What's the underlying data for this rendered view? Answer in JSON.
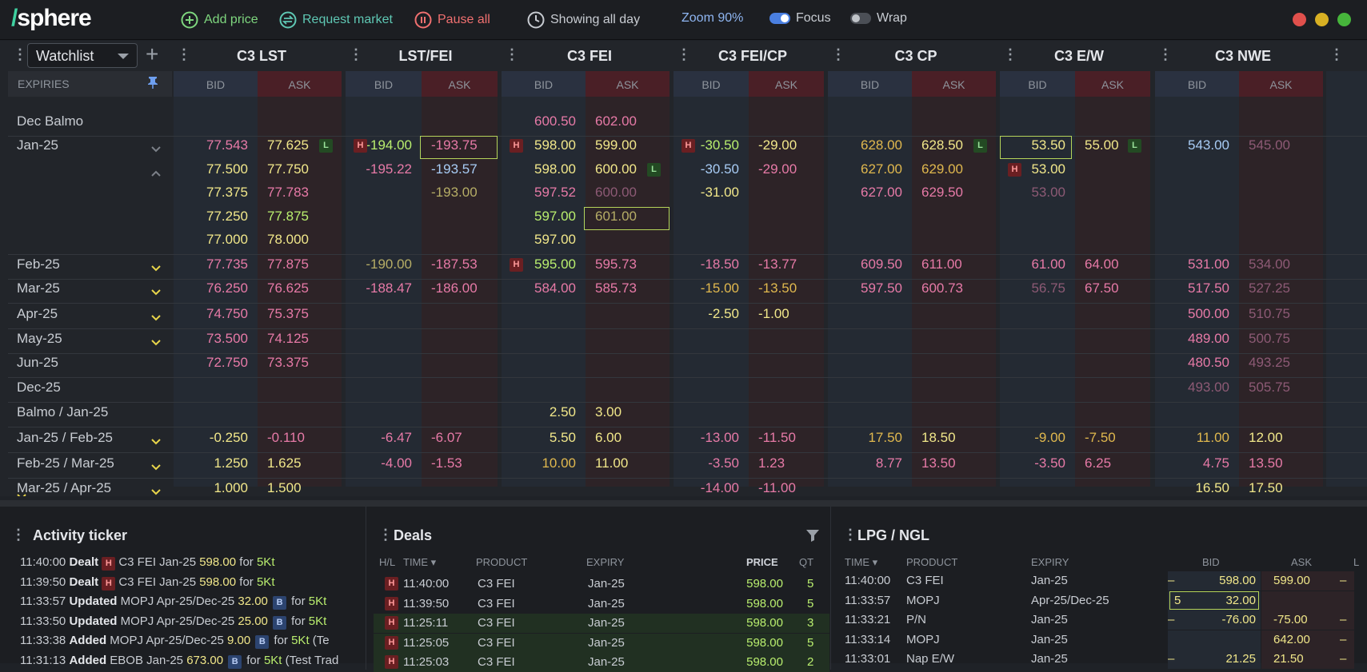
{
  "app": {
    "logo_slash": "/",
    "logo_text": "sphere"
  },
  "toolbar": {
    "add_price": "Add price",
    "request_market": "Request market",
    "pause_all": "Pause all",
    "showing": "Showing all day",
    "zoom": "Zoom 90%",
    "focus": "Focus",
    "wrap": "Wrap",
    "focus_on": true,
    "wrap_on": false
  },
  "colors": {
    "accent": "#3fd1a0",
    "bid_header": "#2a3140",
    "ask_header": "#4a1f26",
    "selection": "#b6d45a"
  },
  "watchlist": {
    "selected": "Watchlist",
    "expiries_label": "EXPIRIES"
  },
  "columns": [
    {
      "name": "C3 LST",
      "bid": "BID",
      "ask": "ASK"
    },
    {
      "name": "LST/FEI",
      "bid": "BID",
      "ask": "ASK"
    },
    {
      "name": "C3 FEI",
      "bid": "BID",
      "ask": "ASK"
    },
    {
      "name": "C3 FEI/CP",
      "bid": "BID",
      "ask": "ASK"
    },
    {
      "name": "C3 CP",
      "bid": "BID",
      "ask": "ASK"
    },
    {
      "name": "C3 E/W",
      "bid": "BID",
      "ask": "ASK"
    },
    {
      "name": "C3 NWE",
      "bid": "BID",
      "ask": "ASK"
    }
  ],
  "rows": [
    {
      "label": "Dec Balmo",
      "chev": ""
    },
    {
      "label": "Jan-25",
      "chev": "down-grey"
    },
    {
      "label": "",
      "chev": "up-grey"
    },
    {
      "label": "",
      "chev": ""
    },
    {
      "label": "",
      "chev": ""
    },
    {
      "label": "",
      "chev": ""
    },
    {
      "label": "Feb-25",
      "chev": "down"
    },
    {
      "label": "Mar-25",
      "chev": "down"
    },
    {
      "label": "Apr-25",
      "chev": "down"
    },
    {
      "label": "May-25",
      "chev": "down"
    },
    {
      "label": "Jun-25",
      "chev": ""
    },
    {
      "label": "Dec-25",
      "chev": ""
    },
    {
      "label": "Balmo / Jan-25",
      "chev": ""
    },
    {
      "label": "Jan-25 / Feb-25",
      "chev": "down"
    },
    {
      "label": "Feb-25 / Mar-25",
      "chev": "down"
    },
    {
      "label": "Mar-25 / Apr-25",
      "chev": "down"
    }
  ],
  "cells": [
    {
      "r": 0,
      "c": 2,
      "bid": "600.50",
      "bc": "p",
      "ask": "602.00",
      "ac": "p"
    },
    {
      "r": 1,
      "c": 0,
      "bid": "77.543",
      "bc": "p",
      "ask": "77.625",
      "ac": "y",
      "bL": true
    },
    {
      "r": 1,
      "c": 1,
      "bid": "-194.00",
      "bc": "g",
      "ask": "-193.75",
      "ac": "p",
      "bH": true,
      "selAsk": true
    },
    {
      "r": 1,
      "c": 2,
      "bid": "598.00",
      "bc": "y",
      "ask": "599.00",
      "ac": "y",
      "bH": true
    },
    {
      "r": 1,
      "c": 3,
      "bid": "-30.50",
      "bc": "g",
      "ask": "-29.00",
      "ac": "y",
      "bH": true
    },
    {
      "r": 1,
      "c": 4,
      "bid": "628.00",
      "bc": "o",
      "ask": "628.50",
      "ac": "y",
      "bL": true
    },
    {
      "r": 1,
      "c": 5,
      "bid": "53.50",
      "bc": "y",
      "ask": "55.00",
      "ac": "y",
      "bL": true,
      "selBid": true
    },
    {
      "r": 1,
      "c": 6,
      "bid": "543.00",
      "bc": "b",
      "ask": "545.00",
      "ac": "dp"
    },
    {
      "r": 2,
      "c": 0,
      "bid": "77.500",
      "bc": "y",
      "ask": "77.750",
      "ac": "y"
    },
    {
      "r": 2,
      "c": 1,
      "bid": "-195.22",
      "bc": "p",
      "ask": "-193.57",
      "ac": "b"
    },
    {
      "r": 2,
      "c": 2,
      "bid": "598.00",
      "bc": "y",
      "ask": "600.00",
      "ac": "y",
      "bL": true
    },
    {
      "r": 2,
      "c": 3,
      "bid": "-30.50",
      "bc": "b",
      "ask": "-29.00",
      "ac": "p"
    },
    {
      "r": 2,
      "c": 4,
      "bid": "627.00",
      "bc": "o",
      "ask": "629.00",
      "ac": "o"
    },
    {
      "r": 2,
      "c": 5,
      "bid": "53.00",
      "bc": "y",
      "ask": "",
      "ac": "y",
      "bHbid": true
    },
    {
      "r": 3,
      "c": 0,
      "bid": "77.375",
      "bc": "y",
      "ask": "77.783",
      "ac": "p"
    },
    {
      "r": 3,
      "c": 1,
      "bid": "",
      "bc": "y",
      "ask": "-193.00",
      "ac": "dy"
    },
    {
      "r": 3,
      "c": 2,
      "bid": "597.52",
      "bc": "p",
      "ask": "600.00",
      "ac": "dp"
    },
    {
      "r": 3,
      "c": 3,
      "bid": "-31.00",
      "bc": "y",
      "ask": "",
      "ac": "y"
    },
    {
      "r": 3,
      "c": 4,
      "bid": "627.00",
      "bc": "p",
      "ask": "629.50",
      "ac": "p"
    },
    {
      "r": 3,
      "c": 5,
      "bid": "53.00",
      "bc": "dp",
      "ask": "",
      "ac": "y"
    },
    {
      "r": 4,
      "c": 0,
      "bid": "77.250",
      "bc": "y",
      "ask": "77.875",
      "ac": "g"
    },
    {
      "r": 4,
      "c": 2,
      "bid": "597.00",
      "bc": "g",
      "ask": "601.00",
      "ac": "dy",
      "selAsk": true
    },
    {
      "r": 5,
      "c": 0,
      "bid": "77.000",
      "bc": "y",
      "ask": "78.000",
      "ac": "y"
    },
    {
      "r": 5,
      "c": 2,
      "bid": "597.00",
      "bc": "y",
      "ask": "",
      "ac": "y"
    },
    {
      "r": 6,
      "c": 0,
      "bid": "77.735",
      "bc": "p",
      "ask": "77.875",
      "ac": "p"
    },
    {
      "r": 6,
      "c": 1,
      "bid": "-190.00",
      "bc": "dy",
      "ask": "-187.53",
      "ac": "p"
    },
    {
      "r": 6,
      "c": 2,
      "bid": "595.00",
      "bc": "g",
      "ask": "595.73",
      "ac": "p",
      "bH": true
    },
    {
      "r": 6,
      "c": 3,
      "bid": "-18.50",
      "bc": "p",
      "ask": "-13.77",
      "ac": "p"
    },
    {
      "r": 6,
      "c": 4,
      "bid": "609.50",
      "bc": "p",
      "ask": "611.00",
      "ac": "p"
    },
    {
      "r": 6,
      "c": 5,
      "bid": "61.00",
      "bc": "p",
      "ask": "64.00",
      "ac": "p"
    },
    {
      "r": 6,
      "c": 6,
      "bid": "531.00",
      "bc": "p",
      "ask": "534.00",
      "ac": "dp"
    },
    {
      "r": 7,
      "c": 0,
      "bid": "76.250",
      "bc": "p",
      "ask": "76.625",
      "ac": "p"
    },
    {
      "r": 7,
      "c": 1,
      "bid": "-188.47",
      "bc": "p",
      "ask": "-186.00",
      "ac": "p"
    },
    {
      "r": 7,
      "c": 2,
      "bid": "584.00",
      "bc": "p",
      "ask": "585.73",
      "ac": "p"
    },
    {
      "r": 7,
      "c": 3,
      "bid": "-15.00",
      "bc": "o",
      "ask": "-13.50",
      "ac": "o"
    },
    {
      "r": 7,
      "c": 4,
      "bid": "597.50",
      "bc": "p",
      "ask": "600.73",
      "ac": "p"
    },
    {
      "r": 7,
      "c": 5,
      "bid": "56.75",
      "bc": "dp",
      "ask": "67.50",
      "ac": "p"
    },
    {
      "r": 7,
      "c": 6,
      "bid": "517.50",
      "bc": "p",
      "ask": "527.25",
      "ac": "dp"
    },
    {
      "r": 8,
      "c": 0,
      "bid": "74.750",
      "bc": "p",
      "ask": "75.375",
      "ac": "p"
    },
    {
      "r": 8,
      "c": 3,
      "bid": "-2.50",
      "bc": "y",
      "ask": "-1.00",
      "ac": "y"
    },
    {
      "r": 8,
      "c": 6,
      "bid": "500.00",
      "bc": "p",
      "ask": "510.75",
      "ac": "dp"
    },
    {
      "r": 9,
      "c": 0,
      "bid": "73.500",
      "bc": "p",
      "ask": "74.125",
      "ac": "p"
    },
    {
      "r": 9,
      "c": 6,
      "bid": "489.00",
      "bc": "p",
      "ask": "500.75",
      "ac": "dp"
    },
    {
      "r": 10,
      "c": 0,
      "bid": "72.750",
      "bc": "p",
      "ask": "73.375",
      "ac": "p"
    },
    {
      "r": 10,
      "c": 6,
      "bid": "480.50",
      "bc": "p",
      "ask": "493.25",
      "ac": "dp"
    },
    {
      "r": 11,
      "c": 6,
      "bid": "493.00",
      "bc": "dp",
      "ask": "505.75",
      "ac": "dp"
    },
    {
      "r": 12,
      "c": 2,
      "bid": "2.50",
      "bc": "y",
      "ask": "3.00",
      "ac": "y"
    },
    {
      "r": 13,
      "c": 0,
      "bid": "-0.250",
      "bc": "y",
      "ask": "-0.110",
      "ac": "p"
    },
    {
      "r": 13,
      "c": 1,
      "bid": "-6.47",
      "bc": "p",
      "ask": "-6.07",
      "ac": "p"
    },
    {
      "r": 13,
      "c": 2,
      "bid": "5.50",
      "bc": "y",
      "ask": "6.00",
      "ac": "y"
    },
    {
      "r": 13,
      "c": 3,
      "bid": "-13.00",
      "bc": "p",
      "ask": "-11.50",
      "ac": "p"
    },
    {
      "r": 13,
      "c": 4,
      "bid": "17.50",
      "bc": "o",
      "ask": "18.50",
      "ac": "y"
    },
    {
      "r": 13,
      "c": 5,
      "bid": "-9.00",
      "bc": "o",
      "ask": "-7.50",
      "ac": "o"
    },
    {
      "r": 13,
      "c": 6,
      "bid": "11.00",
      "bc": "o",
      "ask": "12.00",
      "ac": "y"
    },
    {
      "r": 14,
      "c": 0,
      "bid": "1.250",
      "bc": "y",
      "ask": "1.625",
      "ac": "y"
    },
    {
      "r": 14,
      "c": 1,
      "bid": "-4.00",
      "bc": "p",
      "ask": "-1.53",
      "ac": "p"
    },
    {
      "r": 14,
      "c": 2,
      "bid": "10.00",
      "bc": "o",
      "ask": "11.00",
      "ac": "y"
    },
    {
      "r": 14,
      "c": 3,
      "bid": "-3.50",
      "bc": "p",
      "ask": "1.23",
      "ac": "p"
    },
    {
      "r": 14,
      "c": 4,
      "bid": "8.77",
      "bc": "p",
      "ask": "13.50",
      "ac": "p"
    },
    {
      "r": 14,
      "c": 5,
      "bid": "-3.50",
      "bc": "p",
      "ask": "6.25",
      "ac": "p"
    },
    {
      "r": 14,
      "c": 6,
      "bid": "4.75",
      "bc": "p",
      "ask": "13.50",
      "ac": "p"
    },
    {
      "r": 15,
      "c": 0,
      "bid": "1.000",
      "bc": "y",
      "ask": "1.500",
      "ac": "y"
    },
    {
      "r": 15,
      "c": 3,
      "bid": "-14.00",
      "bc": "p",
      "ask": "-11.00",
      "ac": "p"
    },
    {
      "r": 15,
      "c": 6,
      "bid": "16.50",
      "bc": "y",
      "ask": "17.50",
      "ac": "y"
    }
  ],
  "ticker": {
    "title": "Activity ticker",
    "items": [
      {
        "time": "11:40:00",
        "action": "Dealt",
        "badge": "H",
        "product": "C3 FEI",
        "expiry": "Jan-25",
        "price": "598.00",
        "for": "for",
        "qty": "5Kt",
        "extra": ""
      },
      {
        "time": "11:39:50",
        "action": "Dealt",
        "badge": "H",
        "product": "C3 FEI",
        "expiry": "Jan-25",
        "price": "598.00",
        "for": "for",
        "qty": "5Kt",
        "extra": ""
      },
      {
        "time": "11:33:57",
        "action": "Updated",
        "badge": "",
        "product": "MOPJ",
        "expiry": "Apr-25/Dec-25",
        "price": "32.00",
        "badge2": "B",
        "for": "for",
        "qty": "5Kt",
        "extra": ""
      },
      {
        "time": "11:33:50",
        "action": "Updated",
        "badge": "",
        "product": "MOPJ",
        "expiry": "Apr-25/Dec-25",
        "price": "25.00",
        "badge2": "B",
        "for": "for",
        "qty": "5Kt",
        "extra": ""
      },
      {
        "time": "11:33:38",
        "action": "Added",
        "badge": "",
        "product": "MOPJ",
        "expiry": "Apr-25/Dec-25",
        "price": "9.00",
        "badge2": "B",
        "for": "for",
        "qty": "5Kt",
        "extra": "(Te"
      },
      {
        "time": "11:31:13",
        "action": "Added",
        "badge": "",
        "product": "EBOB",
        "expiry": "Jan-25",
        "price": "673.00",
        "badge2": "B",
        "for": "for",
        "qty": "5Kt",
        "extra": "(Test Trad"
      }
    ]
  },
  "deals": {
    "title": "Deals",
    "headers": {
      "hl": "H/L",
      "time": "TIME",
      "product": "PRODUCT",
      "expiry": "EXPIRY",
      "price": "PRICE",
      "qty": "QT"
    },
    "rows": [
      {
        "hl": "H",
        "time": "11:40:00",
        "product": "C3 FEI",
        "expiry": "Jan-25",
        "price": "598.00",
        "qty": "5"
      },
      {
        "hl": "H",
        "time": "11:39:50",
        "product": "C3 FEI",
        "expiry": "Jan-25",
        "price": "598.00",
        "qty": "5"
      },
      {
        "hl": "H",
        "time": "11:25:11",
        "product": "C3 FEI",
        "expiry": "Jan-25",
        "price": "598.00",
        "qty": "3"
      },
      {
        "hl": "H",
        "time": "11:25:05",
        "product": "C3 FEI",
        "expiry": "Jan-25",
        "price": "598.00",
        "qty": "5"
      },
      {
        "hl": "H",
        "time": "11:25:03",
        "product": "C3 FEI",
        "expiry": "Jan-25",
        "price": "598.00",
        "qty": "2"
      }
    ]
  },
  "lpg": {
    "title": "LPG / NGL",
    "headers": {
      "time": "TIME",
      "product": "PRODUCT",
      "expiry": "EXPIRY",
      "bid": "BID",
      "ask": "ASK",
      "extra": "L"
    },
    "rows": [
      {
        "time": "11:40:00",
        "product": "C3 FEI",
        "expiry": "Jan-25",
        "bidq": "–",
        "bid": "598.00",
        "ask": "599.00",
        "askq": "–"
      },
      {
        "time": "11:33:57",
        "product": "MOPJ",
        "expiry": "Apr-25/Dec-25",
        "bidq": "5",
        "bid": "32.00",
        "ask": "",
        "askq": ""
      },
      {
        "time": "11:33:21",
        "product": "P/N",
        "expiry": "Jan-25",
        "bidq": "–",
        "bid": "-76.00",
        "ask": "-75.00",
        "askq": "–"
      },
      {
        "time": "11:33:14",
        "product": "MOPJ",
        "expiry": "Jan-25",
        "bidq": "",
        "bid": "",
        "ask": "642.00",
        "askq": "–"
      },
      {
        "time": "11:33:01",
        "product": "Nap E/W",
        "expiry": "Jan-25",
        "bidq": "–",
        "bid": "21.25",
        "ask": "21.50",
        "askq": "–"
      }
    ]
  }
}
